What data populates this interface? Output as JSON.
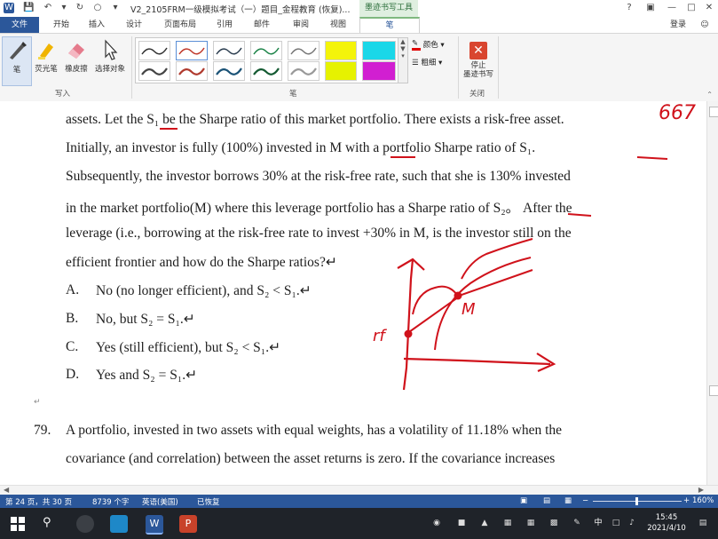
{
  "window": {
    "title": "V2_2105FRM一级模拟考试（一）题目_金程教育 (恢复)...",
    "context_tab_title": "墨迹书写工具",
    "help": "?",
    "minimize": "—",
    "restore": "□",
    "close": "✕"
  },
  "tabs": [
    "开始",
    "插入",
    "设计",
    "页面布局",
    "引用",
    "邮件",
    "审阅",
    "视图"
  ],
  "file_tab": "文件",
  "pen_tab": "笔",
  "signin": "登录",
  "ribbon": {
    "tools": [
      {
        "label": "笔"
      },
      {
        "label": "荧光笔"
      },
      {
        "label": "橡皮擦"
      },
      {
        "label": "选择对象"
      }
    ],
    "group_write": "写入",
    "group_pens": "笔",
    "group_close": "关闭",
    "color_label": "颜色",
    "thickness_label": "粗细",
    "stop_inking": "停止\n墨迹书写",
    "pen_colors": [
      "#333333",
      "#c0392b",
      "#2c3e50",
      "#1e8449",
      "#555555",
      "#f4f40a",
      "#1ad7e8",
      "#444444",
      "#b03a2e",
      "#1a5276",
      "#145a32",
      "#777777",
      "#e6f200",
      "#d11fd1"
    ]
  },
  "document": {
    "q78_lines": [
      "assets. Let the S₁ be the Sharpe ratio of this market portfolio. There exists a risk-free asset.",
      "Initially, an investor is fully (100%) invested in M with a portfolio Sharpe ratio of S₁.",
      "Subsequently, the investor borrows 30% at the risk-free rate, such that she is 130% invested",
      "in the market portfolio(M) where this leverage portfolio has a Sharpe ratio of S₂。 After the",
      "leverage (i.e., borrowing at the risk-free rate to invest +30% in M, is the investor still on the",
      "efficient frontier and how do the Sharpe ratios?↵"
    ],
    "options": [
      {
        "letter": "A.",
        "text": "No (no longer efficient), and  S₂ < S₁.↵"
      },
      {
        "letter": "B.",
        "text": "No, but  S₂ = S₁.↵"
      },
      {
        "letter": "C.",
        "text": "Yes (still efficient), but  S₂ < S₁.↵"
      },
      {
        "letter": "D.",
        "text": "Yes and  S₂ = S₁.↵"
      }
    ],
    "para_mark": "↵",
    "q79_number": "79.",
    "q79_lines": [
      "A portfolio, invested in two assets with equal weights, has a volatility of 11.18% when the",
      "covariance (and correlation) between the asset returns is zero. If the covariance increases"
    ],
    "ink_annotations": [
      "667",
      "M",
      "rf"
    ]
  },
  "status": {
    "page": "第 24 页，共 30 页",
    "words": "8739 个字",
    "language": "英语(美国)",
    "recovered": "已恢复",
    "zoom": "160%"
  },
  "taskbar": {
    "time": "15:45",
    "date": "2021/4/10",
    "ime": "中"
  }
}
